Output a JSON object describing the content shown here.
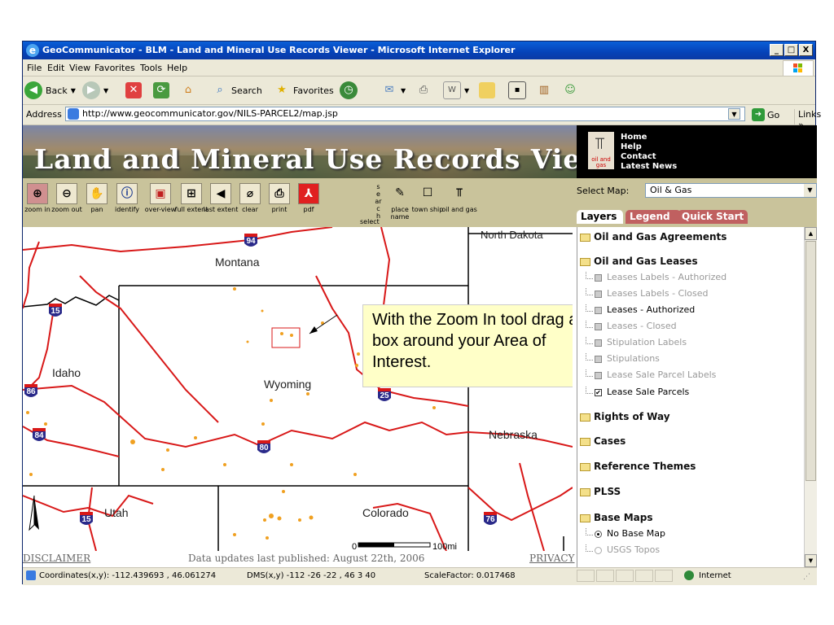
{
  "window": {
    "title": "GeoCommunicator - BLM - Land and Mineral Use Records Viewer - Microsoft Internet Explorer",
    "minimize": "_",
    "maximize": "□",
    "close": "X"
  },
  "menu": {
    "items": [
      "File",
      "Edit",
      "View",
      "Favorites",
      "Tools",
      "Help"
    ]
  },
  "toolbar": {
    "back": "Back",
    "search": "Search",
    "favorites": "Favorites"
  },
  "address": {
    "label": "Address",
    "url": "http://www.geocommunicator.gov/NILS-PARCEL2/map.jsp",
    "go": "Go",
    "links": "Links"
  },
  "banner": {
    "title": "Land and Mineral Use Records Viewer"
  },
  "header_links": [
    "Home",
    "Help",
    "Contact",
    "Latest News"
  ],
  "oil_icon_label": "oil and gas",
  "tools": [
    {
      "label": "zoom in",
      "icon": "zoom-in-icon"
    },
    {
      "label": "zoom out",
      "icon": "zoom-out-icon"
    },
    {
      "label": "pan",
      "icon": "pan-hand-icon"
    },
    {
      "label": "identify",
      "icon": "info-icon"
    },
    {
      "label": "over-view",
      "icon": "overview-icon"
    },
    {
      "label": "full extent",
      "icon": "full-extent-icon"
    },
    {
      "label": "last extent",
      "icon": "back-arrow-icon"
    },
    {
      "label": "clear",
      "icon": "eraser-icon"
    },
    {
      "label": "print",
      "icon": "printer-icon"
    },
    {
      "label": "pdf",
      "icon": "pdf-icon"
    }
  ],
  "search_tools": {
    "search_vertical": "search",
    "select_label": "select",
    "items": [
      {
        "label": "place name",
        "icon": "pencil-icon"
      },
      {
        "label": "town ship",
        "icon": "square-icon"
      },
      {
        "label": "oil and gas",
        "icon": "oil-derrick-icon"
      }
    ]
  },
  "select_map": {
    "label": "Select Map:",
    "value": "Oil & Gas"
  },
  "tabs": [
    "Layers",
    "Legend",
    "Quick Start"
  ],
  "map": {
    "states": [
      "North Dakota",
      "Montana",
      "Idaho",
      "Wyoming",
      "Nebraska",
      "Utah",
      "Colorado"
    ],
    "interstates": [
      "94",
      "15",
      "86",
      "25",
      "84",
      "80",
      "15",
      "76"
    ],
    "scale_start": "0",
    "scale_end": "100mi",
    "callout": "With the Zoom In tool drag a box around your Area of Interest."
  },
  "map_footer": {
    "disclaimer": "DISCLAIMER",
    "updates": "Data updates last published: August 22th, 2006",
    "privacy": "PRIVACY"
  },
  "layers": [
    {
      "type": "group",
      "label": "Oil and Gas Agreements",
      "open": false
    },
    {
      "type": "group",
      "label": "Oil and Gas Leases",
      "open": true
    },
    {
      "type": "item",
      "label": "Leases Labels - Authorized",
      "enabled": false,
      "checked": false
    },
    {
      "type": "item",
      "label": "Leases Labels - Closed",
      "enabled": false,
      "checked": false
    },
    {
      "type": "item",
      "label": "Leases - Authorized",
      "enabled": true,
      "checked": false
    },
    {
      "type": "item",
      "label": "Leases - Closed",
      "enabled": false,
      "checked": false
    },
    {
      "type": "item",
      "label": "Stipulation Labels",
      "enabled": false,
      "checked": false
    },
    {
      "type": "item",
      "label": "Stipulations",
      "enabled": false,
      "checked": false
    },
    {
      "type": "item",
      "label": "Lease Sale Parcel Labels",
      "enabled": false,
      "checked": false
    },
    {
      "type": "item",
      "label": "Lease Sale Parcels",
      "enabled": true,
      "checked": true
    },
    {
      "type": "group",
      "label": "Rights of Way",
      "open": false
    },
    {
      "type": "group",
      "label": "Cases",
      "open": false
    },
    {
      "type": "group",
      "label": "Reference Themes",
      "open": false
    },
    {
      "type": "group",
      "label": "PLSS",
      "open": false
    },
    {
      "type": "group",
      "label": "Base Maps",
      "open": true
    },
    {
      "type": "radio",
      "label": "No Base Map",
      "enabled": true,
      "checked": true
    },
    {
      "type": "radio",
      "label": "USGS Topos",
      "enabled": false,
      "checked": false
    }
  ],
  "status": {
    "coords": "Coordinates(x,y): -112.439693 , 46.061274",
    "dms": "DMS(x,y) -112  -26  -22   ,  46  3  40",
    "scale": "ScaleFactor: 0.017468",
    "zone": "Internet"
  },
  "colors": {
    "boundary_red": "#d81818",
    "parcel_orange": "#f0a020",
    "toolbar_tan": "#c9c39b"
  }
}
